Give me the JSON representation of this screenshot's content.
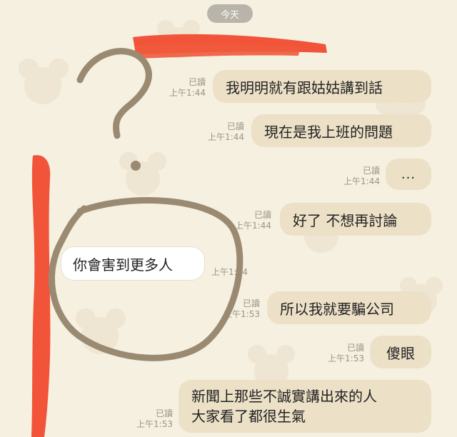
{
  "date_label": "今天",
  "messages": [
    {
      "read": "已讀",
      "time": "上午1:44",
      "text": "我明明就有跟姑姑講到話"
    },
    {
      "read": "已讀",
      "time": "上午1:44",
      "text": "現在是我上班的問題"
    },
    {
      "read": "已讀",
      "time": "上午1:44",
      "text": "..."
    },
    {
      "read": "已讀",
      "time": "上午1:44",
      "text": "好了 不想再討論"
    },
    {
      "time": "上午1:44",
      "incoming_text": "你會害到更多人"
    },
    {
      "read": "已讀",
      "time": "上午1:53",
      "text": "所以我就要騙公司"
    },
    {
      "read": "已讀",
      "time": "上午1:53",
      "text": "傻眼"
    },
    {
      "read": "已讀",
      "time": "上午1:53",
      "lines": [
        "新聞上那些不誠實講出來的人",
        "大家看了都很生氣"
      ]
    }
  ],
  "colors": {
    "background": "#f6f0e1",
    "outgoing_bubble": "#ece0c7",
    "incoming_bubble": "#ffffff",
    "red_scribble": "#f2543a",
    "brown_marker": "#9a8a72"
  }
}
